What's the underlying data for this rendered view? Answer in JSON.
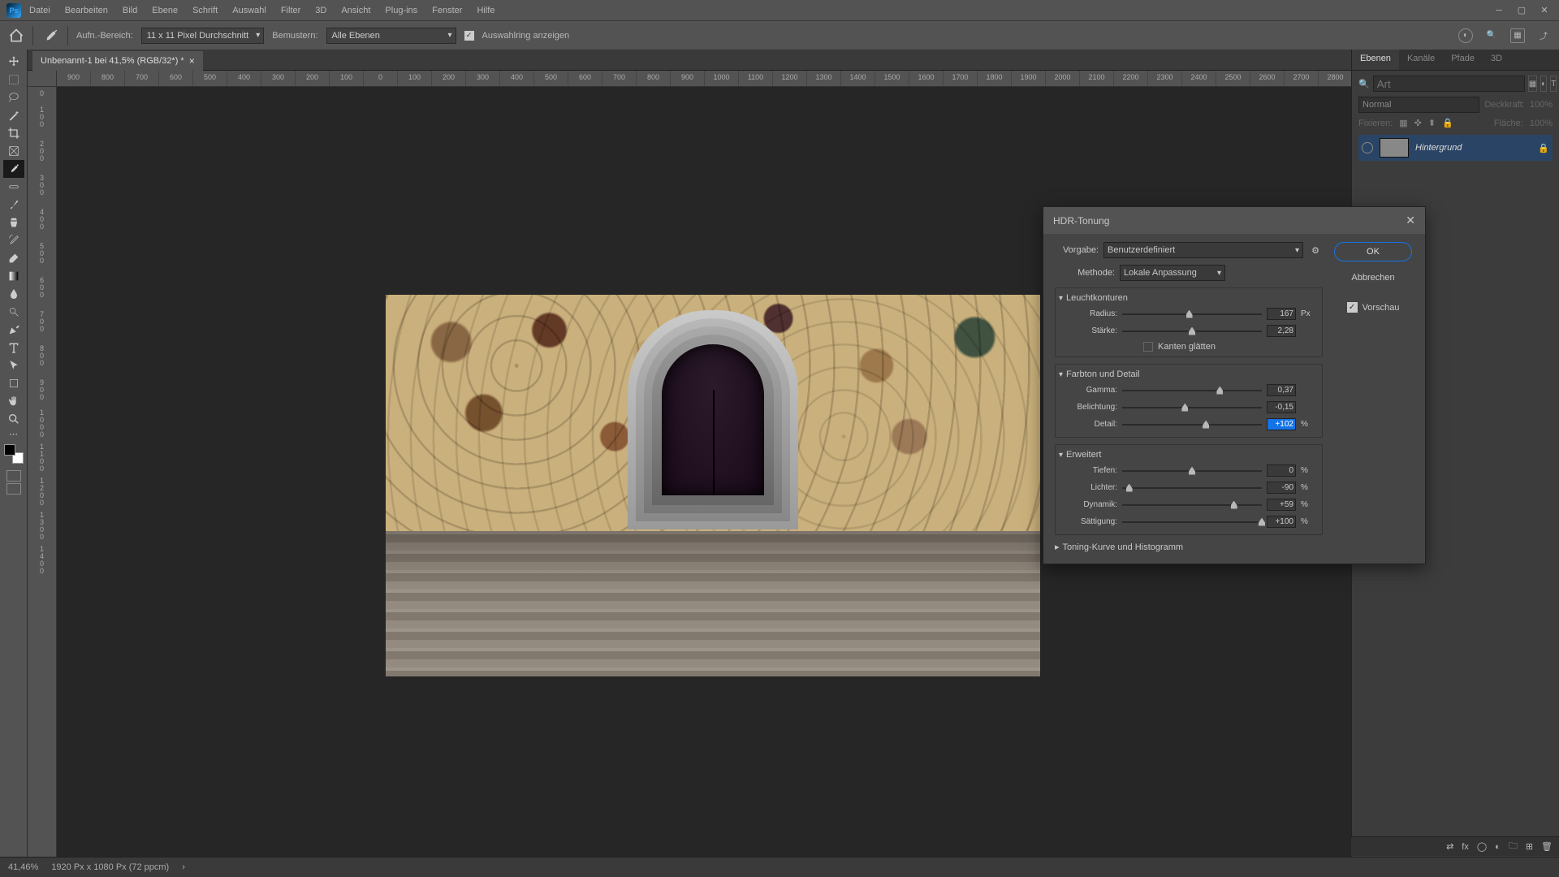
{
  "menubar": {
    "items": [
      "Datei",
      "Bearbeiten",
      "Bild",
      "Ebene",
      "Schrift",
      "Auswahl",
      "Filter",
      "3D",
      "Ansicht",
      "Plug-ins",
      "Fenster",
      "Hilfe"
    ]
  },
  "options": {
    "aufn_label": "Aufn.-Bereich:",
    "aufn_value": "11 x 11 Pixel Durchschnitt",
    "beispiel_label": "Bemustern:",
    "beispiel_value": "Alle Ebenen",
    "show_selection": "Auswahlring anzeigen"
  },
  "doc_tab": {
    "title": "Unbenannt-1 bei 41,5% (RGB/32*) *"
  },
  "ruler_top": [
    "900",
    "800",
    "700",
    "600",
    "500",
    "400",
    "300",
    "200",
    "100",
    "0",
    "100",
    "200",
    "300",
    "400",
    "500",
    "600",
    "700",
    "800",
    "900",
    "1000",
    "1100",
    "1200",
    "1300",
    "1400",
    "1500",
    "1600",
    "1700",
    "1800",
    "1900",
    "2000",
    "2100",
    "2200",
    "2300",
    "2400",
    "2500",
    "2600",
    "2700",
    "2800"
  ],
  "ruler_left": [
    "0",
    "1 0 0",
    "2 0 0",
    "3 0 0",
    "4 0 0",
    "5 0 0",
    "6 0 0",
    "7 0 0",
    "8 0 0",
    "9 0 0",
    "1 0 0 0",
    "1 1 0 0",
    "1 2 0 0",
    "1 3 0 0",
    "1 4 0 0"
  ],
  "panels": {
    "tabs": [
      "Ebenen",
      "Kanäle",
      "Pfade",
      "3D"
    ],
    "search_placeholder": "Art",
    "blend_mode": "Normal",
    "opacity_label": "Deckkraft:",
    "opacity_value": "100%",
    "lock_label": "Fixieren:",
    "fill_label": "Fläche:",
    "fill_value": "100%",
    "layer_name": "Hintergrund"
  },
  "status": {
    "zoom": "41,46%",
    "doc_info": "1920 Px x 1080 Px (72 ppcm)"
  },
  "dialog": {
    "title": "HDR-Tonung",
    "preset_label": "Vorgabe:",
    "preset_value": "Benutzerdefiniert",
    "method_label": "Methode:",
    "method_value": "Lokale Anpassung",
    "ok": "OK",
    "cancel": "Abbrechen",
    "preview": "Vorschau",
    "sections": {
      "glow": {
        "title": "Leuchtkonturen",
        "radius_label": "Radius:",
        "radius": "167",
        "radius_unit": "Px",
        "strength_label": "Stärke:",
        "strength": "2,28",
        "smooth": "Kanten glätten"
      },
      "tone": {
        "title": "Farbton und Detail",
        "gamma_label": "Gamma:",
        "gamma": "0,37",
        "exposure_label": "Belichtung:",
        "exposure": "-0,15",
        "detail_label": "Detail:",
        "detail": "+102",
        "detail_unit": "%"
      },
      "advanced": {
        "title": "Erweitert",
        "shadows_label": "Tiefen:",
        "shadows": "0",
        "highlights_label": "Lichter:",
        "highlights": "-90",
        "vibrance_label": "Dynamik:",
        "vibrance": "+59",
        "saturation_label": "Sättigung:",
        "saturation": "+100",
        "unit": "%"
      },
      "curve": {
        "title": "Toning-Kurve und Histogramm"
      }
    }
  }
}
